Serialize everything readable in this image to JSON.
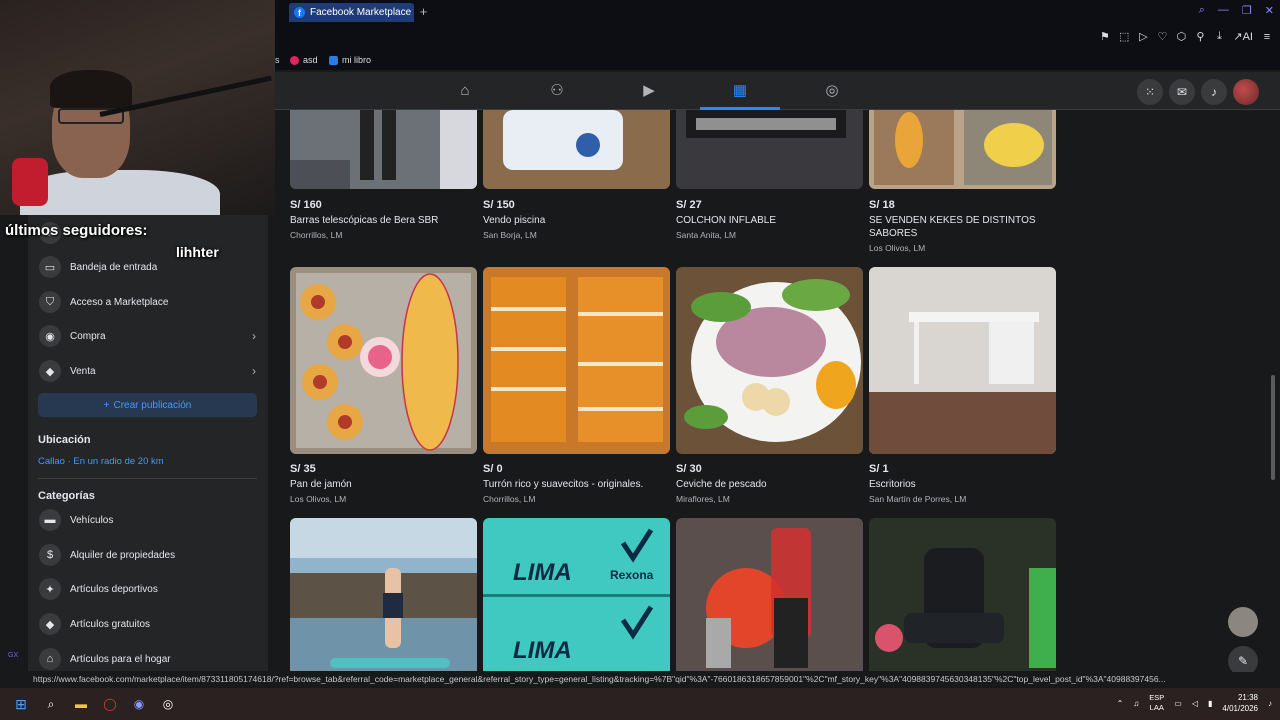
{
  "browser": {
    "tab_title": "Facebook Marketplace | F",
    "new_tab": "+",
    "window_controls": [
      "⌕",
      "—",
      "❐",
      "✕"
    ],
    "toolbar_icons": [
      "⚑",
      "⬚",
      "▷",
      "♡",
      "⬡",
      "⚲",
      "⤓",
      "↗AI",
      "≡"
    ],
    "bookmarks": [
      {
        "label": "s"
      },
      {
        "label": "asd"
      },
      {
        "label": "mi libro"
      }
    ],
    "status_url": "https://www.facebook.com/marketplace/item/873311805174618/?ref=browse_tab&referral_code=marketplace_general&referral_story_type=general_listing&tracking=%7B\"qid\"%3A\"-7660186318657859001\"%2C\"mf_story_key\"%3A\"4098839745630348135\"%2C\"top_level_post_id\"%3A\"40988397456..."
  },
  "overlay": {
    "followers_label": "últimos seguidores:",
    "follower_name": "lihhter"
  },
  "sidebar": {
    "items": [
      {
        "label": "Bandeja de entrada",
        "icon": "inbox-icon",
        "glyph": "▭"
      },
      {
        "label": "Acceso a Marketplace",
        "icon": "shield-icon",
        "glyph": "⛉"
      },
      {
        "label": "Compra",
        "icon": "bag-icon",
        "glyph": "◉",
        "chevron": "›"
      },
      {
        "label": "Venta",
        "icon": "tag-icon",
        "glyph": "◆",
        "chevron": "›"
      }
    ],
    "create_label": "Crear publicación",
    "location_title": "Ubicación",
    "location_value": "Callao · En un radio de 20 km",
    "categories_title": "Categorías",
    "categories": [
      {
        "label": "Vehículos",
        "icon": "car-icon",
        "glyph": "▬"
      },
      {
        "label": "Alquiler de propiedades",
        "icon": "house-dollar-icon",
        "glyph": "$"
      },
      {
        "label": "Artículos deportivos",
        "icon": "running-icon",
        "glyph": "✦"
      },
      {
        "label": "Artículos gratuitos",
        "icon": "tag-icon",
        "glyph": "◆"
      },
      {
        "label": "Artículos para el hogar",
        "icon": "home-icon",
        "glyph": "⌂"
      }
    ]
  },
  "listings_row1": [
    {
      "price": "S/ 160",
      "title": "Barras telescópicas de Bera SBR",
      "location": "Chorrillos, LM",
      "bg": "#6c7178"
    },
    {
      "price": "S/ 150",
      "title": "Vendo piscina",
      "location": "San Borja, LM",
      "bg": "#8a6b4c"
    },
    {
      "price": "S/ 27",
      "title": "COLCHON INFLABLE",
      "location": "Santa Anita, LM",
      "bg": "#3a3a3e"
    },
    {
      "price": "S/ 18",
      "title": "SE VENDEN KEKES DE DISTINTOS SABORES",
      "location": "Los Olivos, LM",
      "bg": "#b9a48a"
    }
  ],
  "listings_row2": [
    {
      "price": "S/ 35",
      "title": "Pan de jamón",
      "location": "Los Olivos, LM",
      "bg": "#9a8f7e"
    },
    {
      "price": "S/ 0",
      "title": "Turrón rico y suavecitos - originales.",
      "location": "Chorrillos, LM",
      "bg": "#c9782a"
    },
    {
      "price": "S/ 30",
      "title": "Ceviche de pescado",
      "location": "Miraflores, LM",
      "bg": "#6b5238"
    },
    {
      "price": "S/ 1",
      "title": "Escritorios",
      "location": "San Martín de Porres, LM",
      "bg": "#9c8b80"
    }
  ],
  "listings_row3": [
    {
      "bg": "#6f93a8",
      "text": ""
    },
    {
      "bg": "#3fc9c0",
      "text": "Rexona"
    },
    {
      "bg": "#5a4f4c",
      "text": ""
    },
    {
      "bg": "#2a3126",
      "text": ""
    }
  ],
  "taskbar": {
    "lang_top": "ESP",
    "lang_bottom": "LAA",
    "time": "21:38",
    "date": "4/01/2026"
  },
  "colors": {
    "accent": "#2d88ff",
    "background": "#18191a",
    "panel": "#242526"
  }
}
